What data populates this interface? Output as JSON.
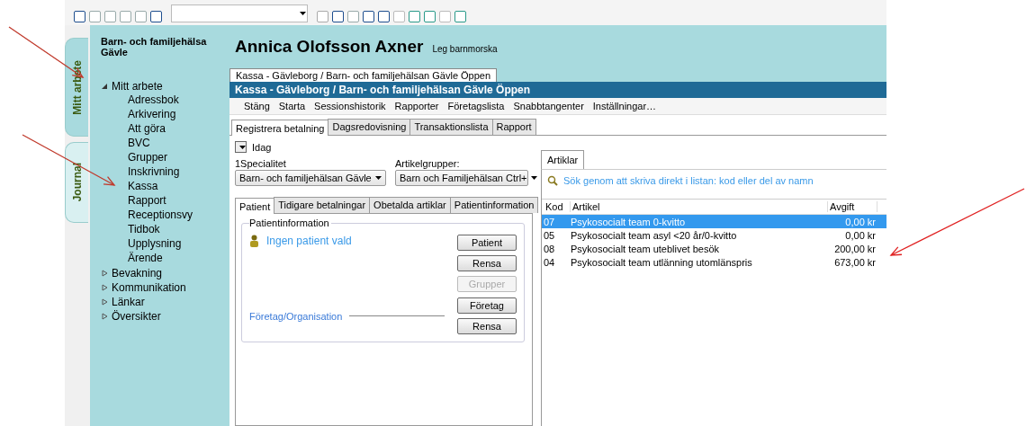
{
  "sidebar_tabs": [
    {
      "label": "Mitt arbete",
      "selected": true
    },
    {
      "label": "Journal",
      "selected": false
    }
  ],
  "sidebar": {
    "title": "Barn- och familjehälsa Gävle",
    "tree": [
      {
        "label": "Mitt arbete",
        "expanded": true,
        "children": [
          {
            "label": "Adressbok"
          },
          {
            "label": "Arkivering"
          },
          {
            "label": "Att göra"
          },
          {
            "label": "BVC"
          },
          {
            "label": "Grupper"
          },
          {
            "label": "Inskrivning"
          },
          {
            "label": "Kassa"
          },
          {
            "label": "Rapport"
          },
          {
            "label": "Receptionsvy"
          },
          {
            "label": "Tidbok"
          },
          {
            "label": "Upplysning"
          },
          {
            "label": "Ärende"
          }
        ]
      },
      {
        "label": "Bevakning",
        "expanded": false
      },
      {
        "label": "Kommunikation",
        "expanded": false
      },
      {
        "label": "Länkar",
        "expanded": false
      },
      {
        "label": "Översikter",
        "expanded": false
      }
    ]
  },
  "header": {
    "name": "Annica Olofsson Axner",
    "role": "Leg barnmorska"
  },
  "document_tabs": [
    {
      "label": "Kassa - Gävleborg / Barn- och familjehälsan Gävle Öppen",
      "selected": true
    }
  ],
  "panel_title": "Kassa - Gävleborg / Barn- och familjehälsan Gävle Öppen",
  "menu": [
    "Stäng",
    "Starta",
    "Sessionshistorik",
    "Rapporter",
    "Företagslista",
    "Snabbtangenter",
    "Inställningar…"
  ],
  "tabs": [
    {
      "label": "Registrera betalning",
      "selected": true
    },
    {
      "label": "Dagsredovisning",
      "selected": false
    },
    {
      "label": "Transaktionslista",
      "selected": false
    },
    {
      "label": "Rapport",
      "selected": false
    }
  ],
  "date_filter": {
    "label": "Idag"
  },
  "specialitet": {
    "label": "1Specialitet",
    "value": "Barn- och familjehälsan Gävle"
  },
  "artikelgrupper": {
    "label": "Artikelgrupper:",
    "value": "Barn och Familjehälsan Ctrl+"
  },
  "patient_tabs": [
    {
      "label": "Patient",
      "selected": true
    },
    {
      "label": "Tidigare betalningar",
      "selected": false
    },
    {
      "label": "Obetalda artiklar",
      "selected": false
    },
    {
      "label": "Patientinformation",
      "selected": false
    }
  ],
  "patient_group": {
    "title": "Patientinformation",
    "status": "Ingen patient vald",
    "buttons": [
      {
        "label": "Patient",
        "disabled": false
      },
      {
        "label": "Rensa",
        "disabled": false
      },
      {
        "label": "Grupper",
        "disabled": true
      }
    ]
  },
  "company_group": {
    "title": "Företag/Organisation",
    "buttons": [
      {
        "label": "Företag",
        "disabled": false
      },
      {
        "label": "Rensa",
        "disabled": false
      }
    ]
  },
  "articles": {
    "tab": "Artiklar",
    "search_placeholder": "Sök genom att skriva direkt i listan: kod eller del av namn",
    "columns": [
      "Kod",
      "Artikel",
      "Avgift"
    ],
    "rows": [
      {
        "code": "07",
        "name": "Psykosocialt team 0-kvitto",
        "fee": "0,00 kr",
        "selected": true
      },
      {
        "code": "05",
        "name": "Psykosocialt team asyl <20 år/0-kvitto",
        "fee": "0,00 kr",
        "selected": false
      },
      {
        "code": "08",
        "name": "Psykosocialt team uteblivet besök",
        "fee": "200,00 kr",
        "selected": false
      },
      {
        "code": "04",
        "name": "Psykosocialt team utlänning utomlänspris",
        "fee": "673,00 kr",
        "selected": false
      }
    ]
  }
}
